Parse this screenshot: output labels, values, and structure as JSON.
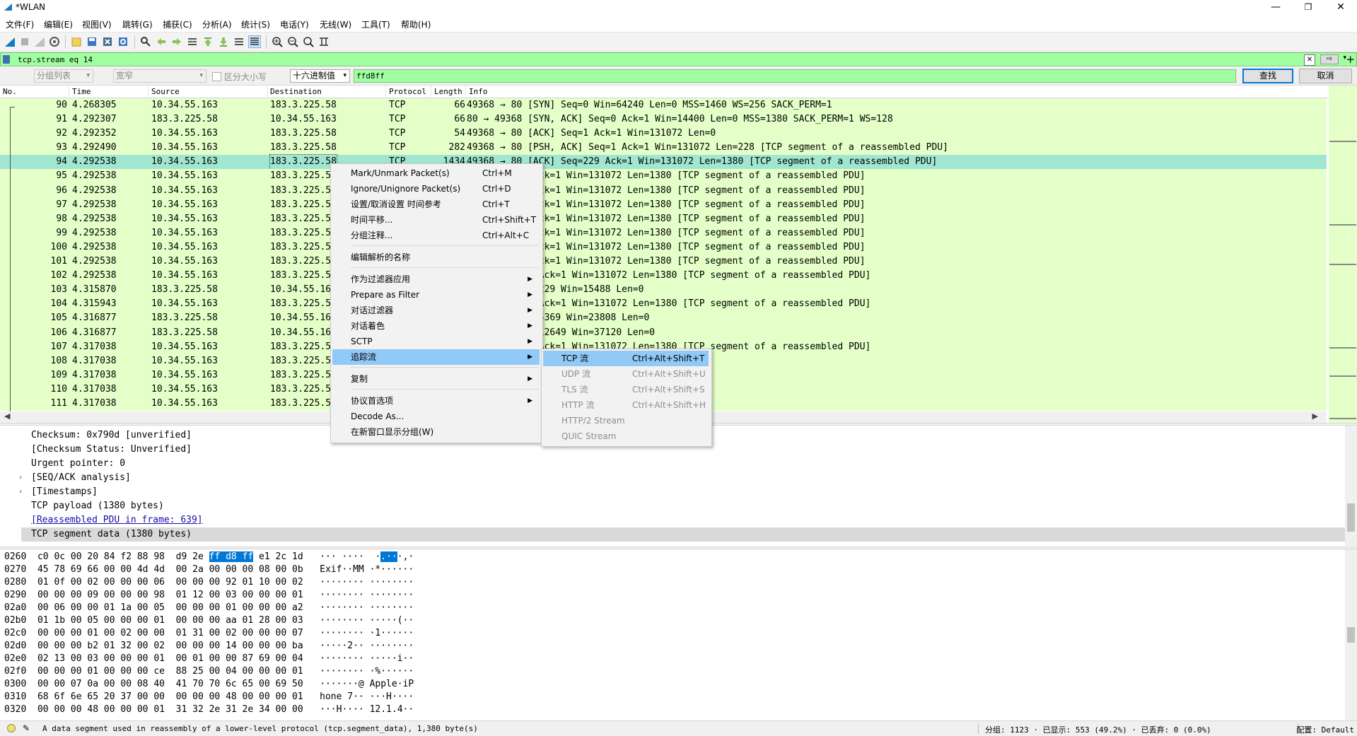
{
  "window": {
    "title": "*WLAN",
    "controls": {
      "minimize": "—",
      "maximize": "❐",
      "close": "✕"
    }
  },
  "menubar": [
    "文件(F)",
    "编辑(E)",
    "视图(V)",
    "跳转(G)",
    "捕获(C)",
    "分析(A)",
    "统计(S)",
    "电话(Y)",
    "无线(W)",
    "工具(T)",
    "帮助(H)"
  ],
  "display_filter": {
    "value": "tcp.stream eq 14",
    "arrow": "⇨",
    "dropdown": "▾",
    "add": "+"
  },
  "find_bar": {
    "search_in": "分组列表",
    "char_width": "宽窄",
    "case_sensitive_label": "区分大小写",
    "display_format": "十六进制值",
    "search_value": "ffd8ff",
    "find_button": "查找",
    "cancel_button": "取消"
  },
  "packet_list": {
    "columns": [
      "No.",
      "Time",
      "Source",
      "Destination",
      "Protocol",
      "Length",
      "Info"
    ],
    "rows": [
      {
        "no": "90",
        "time": "4.268305",
        "src": "10.34.55.163",
        "dst": "183.3.225.58",
        "proto": "TCP",
        "len": "66",
        "info": "49368 → 80 [SYN] Seq=0 Win=64240 Len=0 MSS=1460 WS=256 SACK_PERM=1"
      },
      {
        "no": "91",
        "time": "4.292307",
        "src": "183.3.225.58",
        "dst": "10.34.55.163",
        "proto": "TCP",
        "len": "66",
        "info": "80 → 49368 [SYN, ACK] Seq=0 Ack=1 Win=14400 Len=0 MSS=1380 SACK_PERM=1 WS=128"
      },
      {
        "no": "92",
        "time": "4.292352",
        "src": "10.34.55.163",
        "dst": "183.3.225.58",
        "proto": "TCP",
        "len": "54",
        "info": "49368 → 80 [ACK] Seq=1 Ack=1 Win=131072 Len=0"
      },
      {
        "no": "93",
        "time": "4.292490",
        "src": "10.34.55.163",
        "dst": "183.3.225.58",
        "proto": "TCP",
        "len": "282",
        "info": "49368 → 80 [PSH, ACK] Seq=1 Ack=1 Win=131072 Len=228 [TCP segment of a reassembled PDU]"
      },
      {
        "no": "94",
        "time": "4.292538",
        "src": "10.34.55.163",
        "dst": "183.3.225.58",
        "proto": "TCP",
        "len": "1434",
        "info": "49368 → 80 [ACK] Seq=229 Ack=1 Win=131072 Len=1380 [TCP segment of a reassembled PDU]"
      },
      {
        "no": "95",
        "time": "4.292538",
        "src": "10.34.55.163",
        "dst": "183.3.225.5",
        "proto": "",
        "len": "",
        "info": "K] Seq=1609 Ack=1 Win=131072 Len=1380 [TCP segment of a reassembled PDU]"
      },
      {
        "no": "96",
        "time": "4.292538",
        "src": "10.34.55.163",
        "dst": "183.3.225.5",
        "proto": "",
        "len": "",
        "info": "K] Seq=2989 Ack=1 Win=131072 Len=1380 [TCP segment of a reassembled PDU]"
      },
      {
        "no": "97",
        "time": "4.292538",
        "src": "10.34.55.163",
        "dst": "183.3.225.5",
        "proto": "",
        "len": "",
        "info": "K] Seq=4369 Ack=1 Win=131072 Len=1380 [TCP segment of a reassembled PDU]"
      },
      {
        "no": "98",
        "time": "4.292538",
        "src": "10.34.55.163",
        "dst": "183.3.225.5",
        "proto": "",
        "len": "",
        "info": "K] Seq=5749 Ack=1 Win=131072 Len=1380 [TCP segment of a reassembled PDU]"
      },
      {
        "no": "99",
        "time": "4.292538",
        "src": "10.34.55.163",
        "dst": "183.3.225.5",
        "proto": "",
        "len": "",
        "info": "K] Seq=7129 Ack=1 Win=131072 Len=1380 [TCP segment of a reassembled PDU]"
      },
      {
        "no": "100",
        "time": "4.292538",
        "src": "10.34.55.163",
        "dst": "183.3.225.5",
        "proto": "",
        "len": "",
        "info": "K] Seq=8509 Ack=1 Win=131072 Len=1380 [TCP segment of a reassembled PDU]"
      },
      {
        "no": "101",
        "time": "4.292538",
        "src": "10.34.55.163",
        "dst": "183.3.225.5",
        "proto": "",
        "len": "",
        "info": "K] Seq=9889 Ack=1 Win=131072 Len=1380 [TCP segment of a reassembled PDU]"
      },
      {
        "no": "102",
        "time": "4.292538",
        "src": "10.34.55.163",
        "dst": "183.3.225.5",
        "proto": "",
        "len": "",
        "info": "K] Seq=11269 Ack=1 Win=131072 Len=1380 [TCP segment of a reassembled PDU]"
      },
      {
        "no": "103",
        "time": "4.315870",
        "src": "183.3.225.58",
        "dst": "10.34.55.16",
        "proto": "",
        "len": "",
        "info": "K] Seq=1 Ack=229 Win=15488 Len=0"
      },
      {
        "no": "104",
        "time": "4.315943",
        "src": "10.34.55.163",
        "dst": "183.3.225.5",
        "proto": "",
        "len": "",
        "info": "K] Seq=12649 Ack=1 Win=131072 Len=1380 [TCP segment of a reassembled PDU]"
      },
      {
        "no": "105",
        "time": "4.316877",
        "src": "183.3.225.58",
        "dst": "10.34.55.16",
        "proto": "",
        "len": "",
        "info": "K] Seq=1 Ack=4369 Win=23808 Len=0"
      },
      {
        "no": "106",
        "time": "4.316877",
        "src": "183.3.225.58",
        "dst": "10.34.55.16",
        "proto": "",
        "len": "",
        "info": "K] Seq=1 Ack=12649 Win=37120 Len=0"
      },
      {
        "no": "107",
        "time": "4.317038",
        "src": "10.34.55.163",
        "dst": "183.3.225.5",
        "proto": "",
        "len": "",
        "info": "K] Seq=14029 Ack=1 Win=131072 Len=1380 [TCP segment of a reassembled PDU]"
      },
      {
        "no": "108",
        "time": "4.317038",
        "src": "10.34.55.163",
        "dst": "183.3.225.5",
        "proto": "",
        "len": "",
        "info": "Len=1380 [TCP segment of a reassembled PDU]"
      },
      {
        "no": "109",
        "time": "4.317038",
        "src": "10.34.55.163",
        "dst": "183.3.225.5",
        "proto": "",
        "len": "",
        "info": "Len=1380 [TCP segment of a reassembled PDU]"
      },
      {
        "no": "110",
        "time": "4.317038",
        "src": "10.34.55.163",
        "dst": "183.3.225.5",
        "proto": "",
        "len": "",
        "info": "Len=1380 [TCP segment of a reassembled PDU]"
      },
      {
        "no": "111",
        "time": "4.317038",
        "src": "10.34.55.163",
        "dst": "183.3.225.5",
        "proto": "",
        "len": "",
        "info": "Len=1380 [TCP segment of a reassembled PDU]"
      }
    ],
    "selected_row": 4,
    "row_color": "#e4ffc7",
    "selected_color": "#a0e6d0"
  },
  "details": [
    {
      "text": "Checksum: 0x790d [unverified]",
      "expandable": false
    },
    {
      "text": "[Checksum Status: Unverified]",
      "expandable": false
    },
    {
      "text": "Urgent pointer: 0",
      "expandable": false
    },
    {
      "text": "[SEQ/ACK analysis]",
      "expandable": true
    },
    {
      "text": "[Timestamps]",
      "expandable": true
    },
    {
      "text": "TCP payload (1380 bytes)",
      "expandable": false
    },
    {
      "text": "[Reassembled PDU in frame: 639]",
      "expandable": false,
      "link": true
    },
    {
      "text": "TCP segment data (1380 bytes)",
      "expandable": false,
      "selected": true
    }
  ],
  "bytes": [
    {
      "off": "0260",
      "hex": "c0 0c 00 20 84 f2 88 98  d9 2e ff d8 ff e1 2c 1d",
      "ascii": "··· ····  ·.···,·"
    },
    {
      "off": "0270",
      "hex": "45 78 69 66 00 00 4d 4d  00 2a 00 00 00 08 00 0b",
      "ascii": "Exif··MM ·*······"
    },
    {
      "off": "0280",
      "hex": "01 0f 00 02 00 00 00 06  00 00 00 92 01 10 00 02",
      "ascii": "········ ········"
    },
    {
      "off": "0290",
      "hex": "00 00 00 09 00 00 00 98  01 12 00 03 00 00 00 01",
      "ascii": "········ ········"
    },
    {
      "off": "02a0",
      "hex": "00 06 00 00 01 1a 00 05  00 00 00 01 00 00 00 a2",
      "ascii": "········ ········"
    },
    {
      "off": "02b0",
      "hex": "01 1b 00 05 00 00 00 01  00 00 00 aa 01 28 00 03",
      "ascii": "········ ·····(··"
    },
    {
      "off": "02c0",
      "hex": "00 00 00 01 00 02 00 00  01 31 00 02 00 00 00 07",
      "ascii": "········ ·1······"
    },
    {
      "off": "02d0",
      "hex": "00 00 00 b2 01 32 00 02  00 00 00 14 00 00 00 ba",
      "ascii": "·····2·· ········"
    },
    {
      "off": "02e0",
      "hex": "02 13 00 03 00 00 00 01  00 01 00 00 87 69 00 04",
      "ascii": "········ ·····i··"
    },
    {
      "off": "02f0",
      "hex": "00 00 00 01 00 00 00 ce  88 25 00 04 00 00 00 01",
      "ascii": "········ ·%······"
    },
    {
      "off": "0300",
      "hex": "00 00 07 0a 00 00 08 40  41 70 70 6c 65 00 69 50",
      "ascii": "·······@ Apple·iP"
    },
    {
      "off": "0310",
      "hex": "68 6f 6e 65 20 37 00 00  00 00 00 48 00 00 00 01",
      "ascii": "hone 7·· ···H····"
    },
    {
      "off": "0320",
      "hex": "00 00 00 48 00 00 00 01  31 32 2e 31 2e 34 00 00",
      "ascii": "···H···· 12.1.4··"
    }
  ],
  "status_bar": {
    "message": "A data segment used in reassembly of a lower-level protocol (tcp.segment_data), 1,380 byte(s)",
    "packets": "分组: 1123 · 已显示: 553 (49.2%) · 已丢弃: 0 (0.0%)",
    "profile": "配置: Default"
  },
  "context_menu": {
    "items": [
      {
        "label": "Mark/Unmark Packet(s)",
        "shortcut": "Ctrl+M"
      },
      {
        "label": "Ignore/Unignore Packet(s)",
        "shortcut": "Ctrl+D"
      },
      {
        "label": "设置/取消设置 时间参考",
        "shortcut": "Ctrl+T"
      },
      {
        "label": "时间平移...",
        "shortcut": "Ctrl+Shift+T"
      },
      {
        "label": "分组注释...",
        "shortcut": "Ctrl+Alt+C"
      },
      {
        "label": "编辑解析的名称",
        "shortcut": ""
      },
      {
        "label": "作为过滤器应用",
        "shortcut": "",
        "submenu": true
      },
      {
        "label": "Prepare as Filter",
        "shortcut": "",
        "submenu": true
      },
      {
        "label": "对话过滤器",
        "shortcut": "",
        "submenu": true
      },
      {
        "label": "对话着色",
        "shortcut": "",
        "submenu": true
      },
      {
        "label": "SCTP",
        "shortcut": "",
        "submenu": true
      },
      {
        "label": "追踪流",
        "shortcut": "",
        "submenu": true,
        "active": true
      },
      {
        "label": "复制",
        "shortcut": "",
        "submenu": true
      },
      {
        "label": "协议首选项",
        "shortcut": "",
        "submenu": true
      },
      {
        "label": "Decode As...",
        "shortcut": ""
      },
      {
        "label": "在新窗口显示分组(W)",
        "shortcut": ""
      }
    ],
    "submenu_arrow": "▶"
  },
  "follow_submenu": {
    "items": [
      {
        "label": "TCP 流",
        "shortcut": "Ctrl+Alt+Shift+T",
        "active": true,
        "enabled": true
      },
      {
        "label": "UDP 流",
        "shortcut": "Ctrl+Alt+Shift+U",
        "enabled": false
      },
      {
        "label": "TLS 流",
        "shortcut": "Ctrl+Alt+Shift+S",
        "enabled": false
      },
      {
        "label": "HTTP 流",
        "shortcut": "Ctrl+Alt+Shift+H",
        "enabled": false
      },
      {
        "label": "HTTP/2 Stream",
        "shortcut": "",
        "enabled": false
      },
      {
        "label": "QUIC Stream",
        "shortcut": "",
        "enabled": false
      }
    ]
  }
}
